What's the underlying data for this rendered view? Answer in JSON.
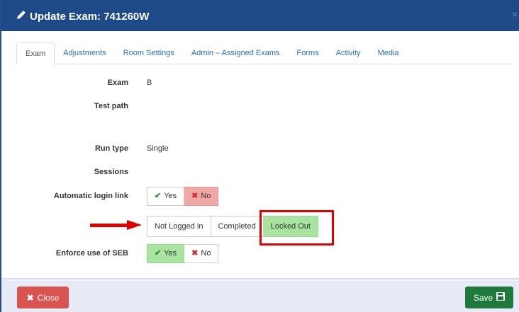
{
  "modal": {
    "title": "Update Exam: 741260W",
    "close_glyph": "×"
  },
  "tabs": [
    {
      "label": "Exam",
      "active": true
    },
    {
      "label": "Adjustments"
    },
    {
      "label": "Room Settings"
    },
    {
      "label": "Admin – Assigned Exams"
    },
    {
      "label": "Forms"
    },
    {
      "label": "Activity"
    },
    {
      "label": "Media"
    }
  ],
  "fields": {
    "exam": {
      "label": "Exam",
      "value": "B"
    },
    "test_path": {
      "label": "Test path",
      "value": ""
    },
    "run_type": {
      "label": "Run type",
      "value": "Single"
    },
    "sessions": {
      "label": "Sessions",
      "value": ""
    },
    "auto_login": {
      "label": "Automatic login link",
      "yes": "Yes",
      "no": "No",
      "selected": "No"
    },
    "status": {
      "options": [
        "Not Logged in",
        "Completed",
        "Locked Out"
      ],
      "selected": "Locked Out"
    },
    "enforce_seb": {
      "label": "Enforce use of SEB",
      "yes": "Yes",
      "no": "No",
      "selected": "Yes"
    }
  },
  "footer": {
    "close_label": "Close",
    "save_label": "Save"
  },
  "colors": {
    "header": "#1f4a8a",
    "active_green": "#a8e3a0",
    "active_red": "#f0a8a6",
    "close_btn": "#d9534f",
    "save_btn": "#1e7a3a",
    "annotation": "#e00000"
  }
}
